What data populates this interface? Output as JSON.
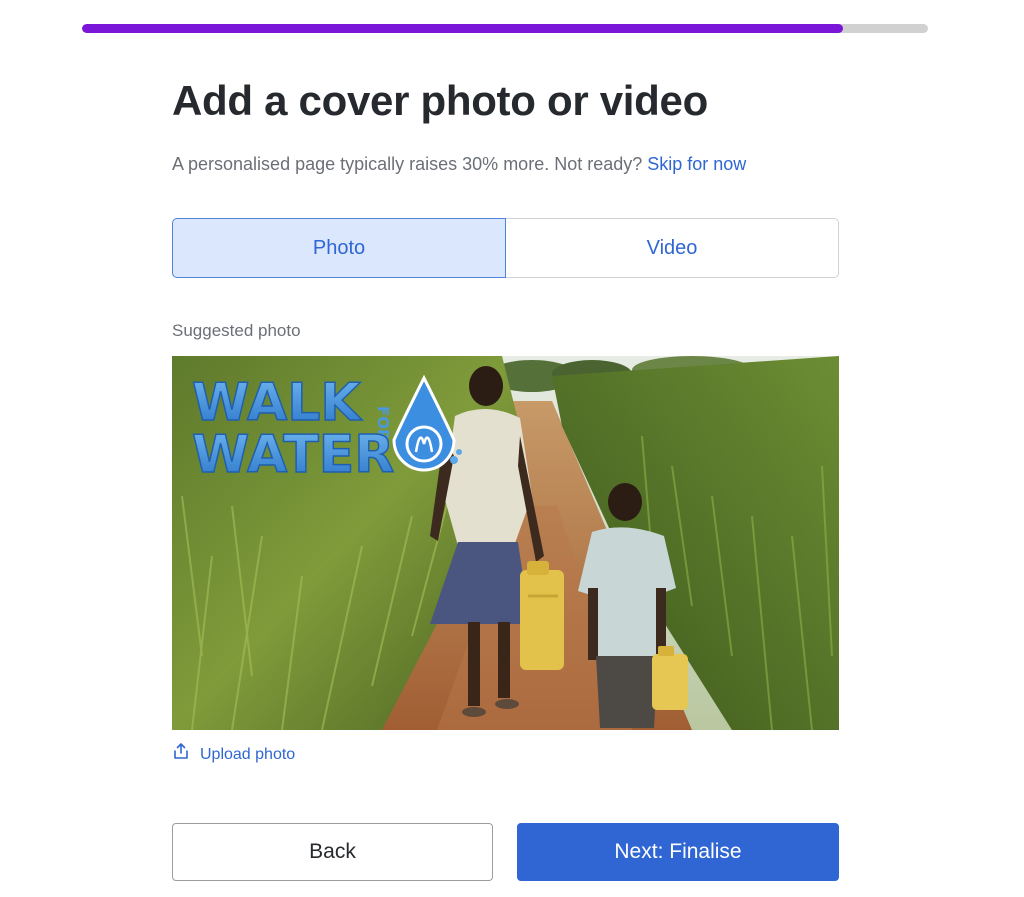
{
  "progress": {
    "fraction": 0.9,
    "fill_color": "#7a16d8",
    "track_color": "#d1d1d1"
  },
  "header": {
    "title": "Add a cover photo or video",
    "subtitle": "A personalised page typically raises 30% more. Not ready?",
    "skip_link": "Skip for now"
  },
  "media_toggle": {
    "options": [
      {
        "label": "Photo",
        "selected": true
      },
      {
        "label": "Video",
        "selected": false
      }
    ]
  },
  "suggested": {
    "label": "Suggested photo",
    "image_logo_text": [
      "WALK",
      "FOR",
      "WATER"
    ],
    "upload_label": "Upload photo"
  },
  "footer": {
    "back_label": "Back",
    "next_label": "Next: Finalise"
  },
  "colors": {
    "accent": "#2f66d3",
    "selected_bg": "#dbe7fd"
  }
}
